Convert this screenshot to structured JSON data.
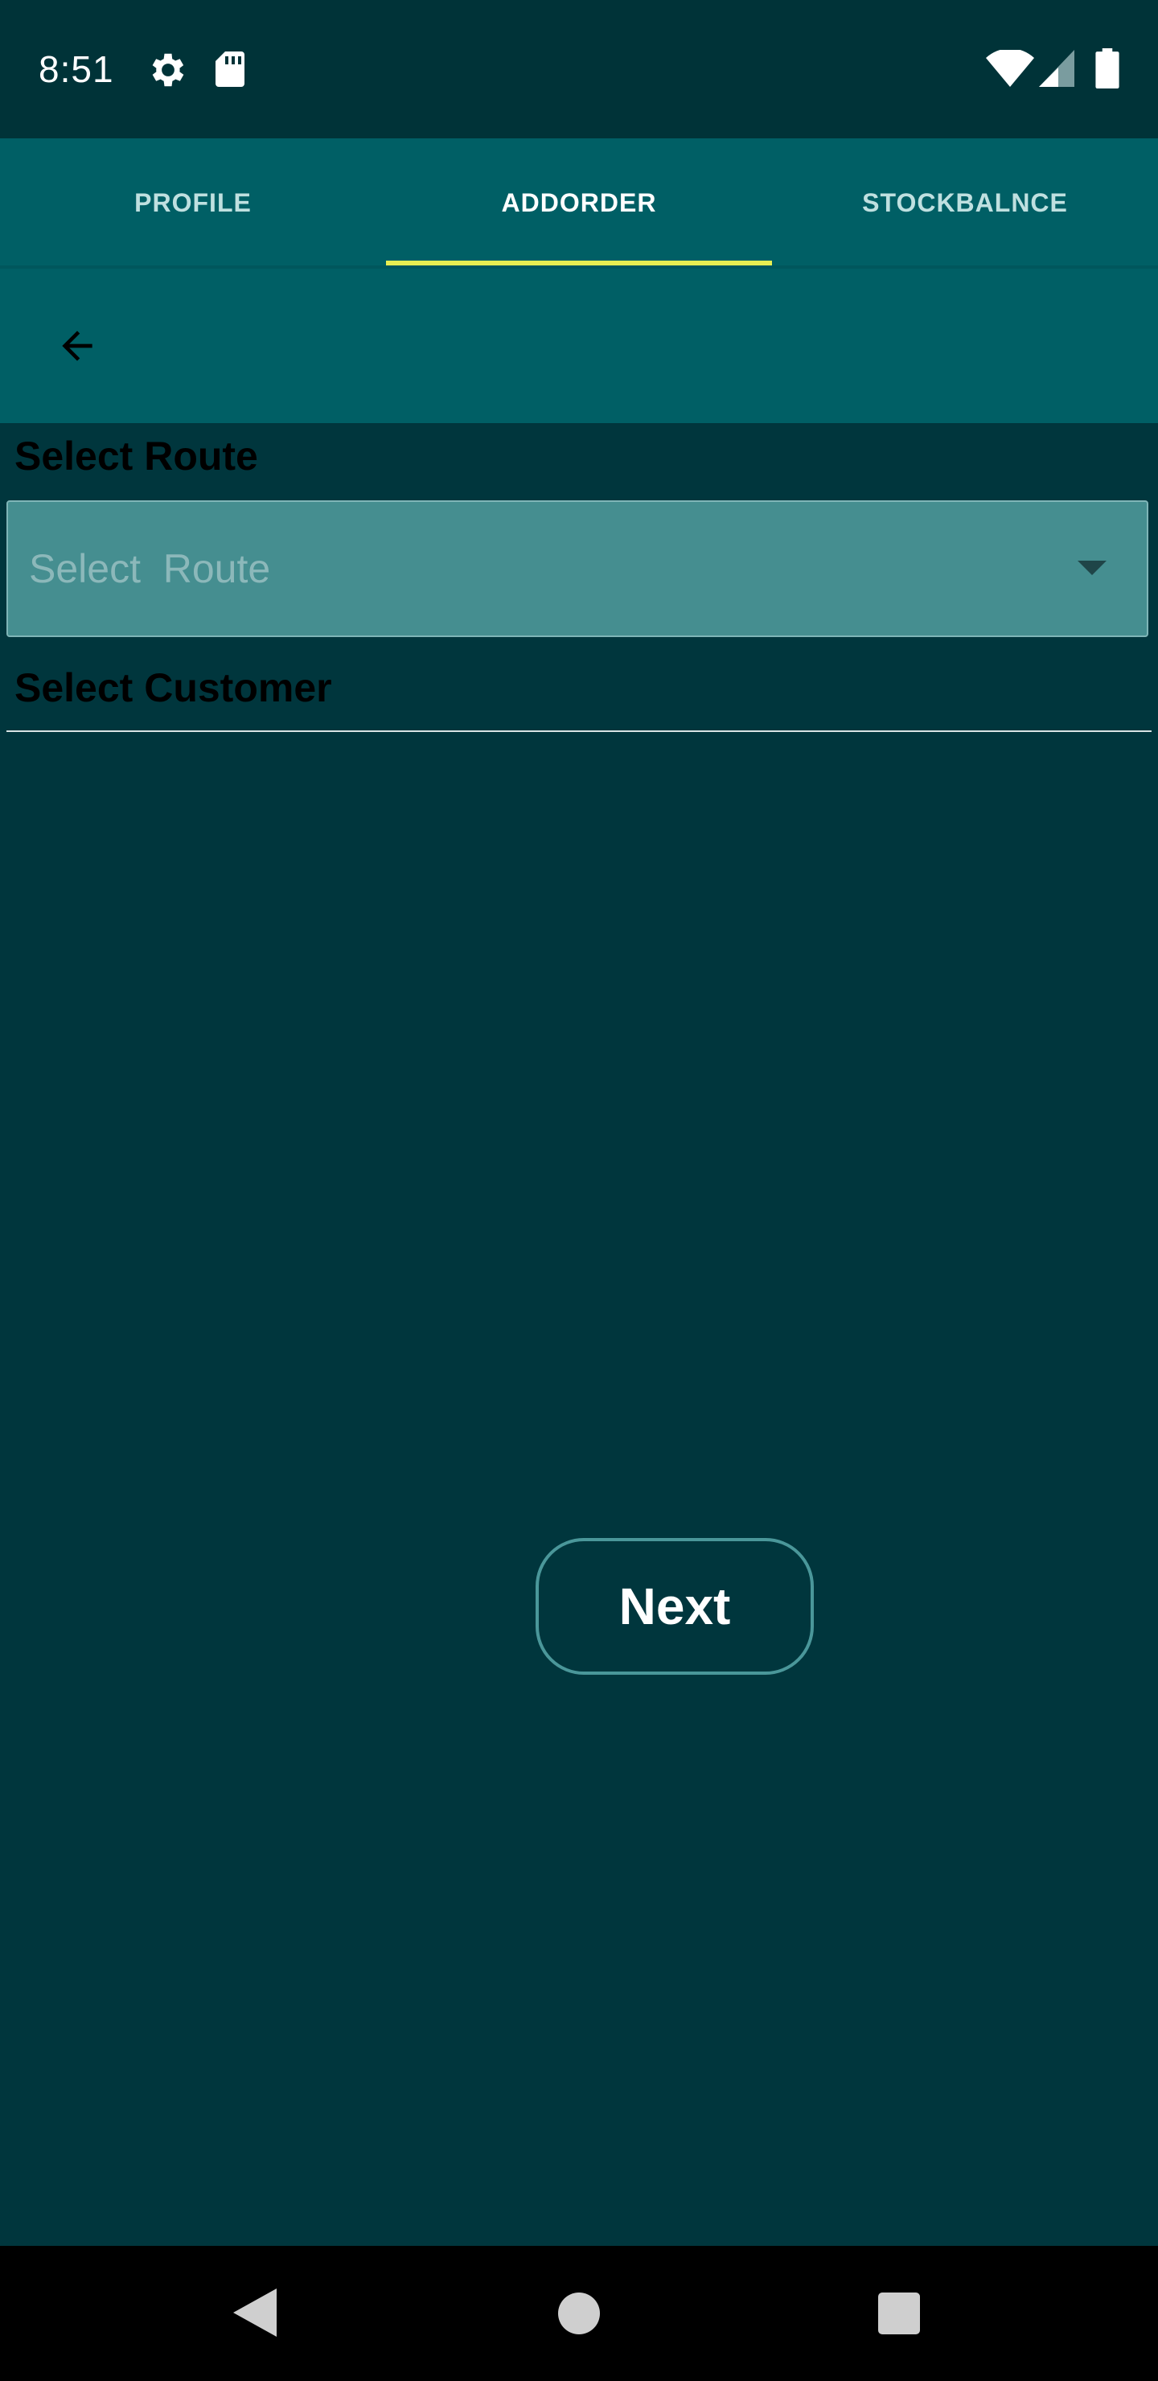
{
  "status_bar": {
    "time": "8:51",
    "icons": [
      "gear-icon",
      "sd-card-icon",
      "wifi-icon",
      "signal-icon",
      "battery-icon"
    ]
  },
  "tabs": [
    {
      "label": "PROFILE",
      "active": false
    },
    {
      "label": "ADDORDER",
      "active": true
    },
    {
      "label": "STOCKBALNCE",
      "active": false
    }
  ],
  "toolbar": {
    "back_icon": "arrow-left-icon"
  },
  "form": {
    "route_label": "Select Route",
    "route_placeholder": "Select  Route",
    "customer_label": "Select Customer",
    "next_label": "Next"
  },
  "nav_bar": {
    "icons": [
      "back-triangle-icon",
      "home-circle-icon",
      "recents-square-icon"
    ]
  },
  "colors": {
    "background": "#00363d",
    "status_bar": "#003338",
    "tab_bar": "#005f65",
    "tab_indicator": "#e8ee52",
    "select_fill": "#458e90",
    "button_border": "#4a979a"
  }
}
